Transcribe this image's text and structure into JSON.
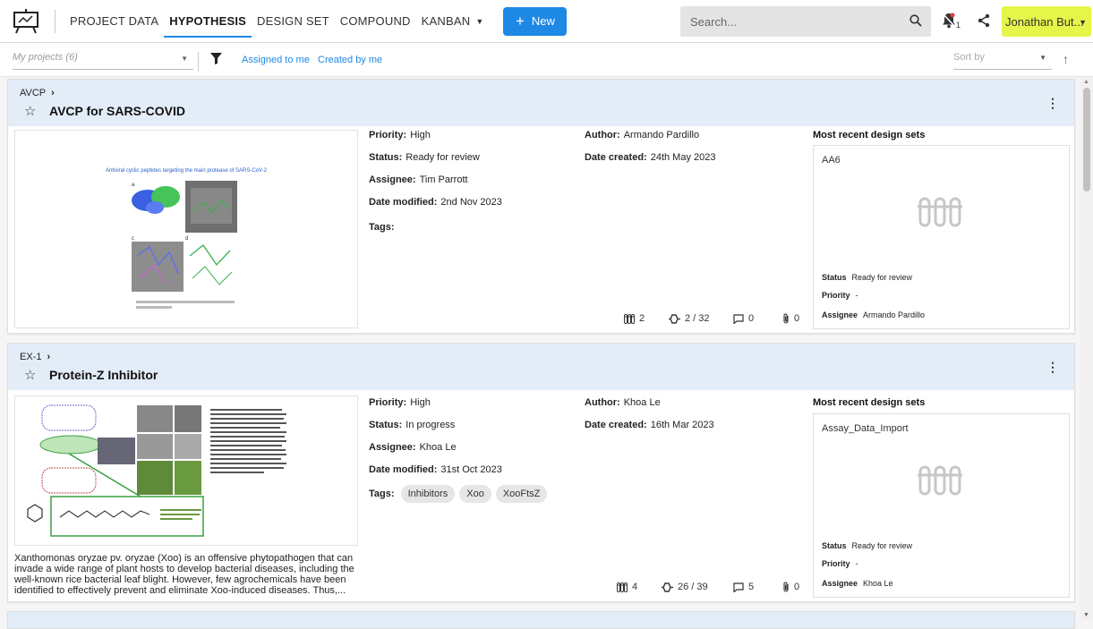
{
  "nav": {
    "items": [
      {
        "label": "PROJECT DATA",
        "active": false
      },
      {
        "label": "HYPOTHESIS",
        "active": true
      },
      {
        "label": "DESIGN SET",
        "active": false
      },
      {
        "label": "COMPOUND",
        "active": false
      },
      {
        "label": "KANBAN",
        "active": false
      }
    ],
    "new_label": "New",
    "search_placeholder": "Search...",
    "notification_count": "1",
    "user_name": "Jonathan But...",
    "accent": "#1e88e5",
    "user_color": "#e6f54a"
  },
  "filters": {
    "projects_placeholder": "My projects (6)",
    "assigned": "Assigned to me",
    "created": "Created by me",
    "sort_placeholder": "Sort by"
  },
  "cards": [
    {
      "code": "AVCP",
      "title": "AVCP for SARS-COVID",
      "priority_label": "Priority:",
      "priority": "High",
      "status_label": "Status:",
      "status": "Ready for review",
      "assignee_label": "Assignee:",
      "assignee": "Tim Parrott",
      "modified_label": "Date modified:",
      "modified": "2nd Nov 2023",
      "tags_label": "Tags:",
      "tags": [],
      "author_label": "Author:",
      "author": "Armando Pardillo",
      "created_label": "Date created:",
      "created": "24th May 2023",
      "image_caption": "Antiviral cyclic peptides targeting the main protease of SARS-CoV-2",
      "description": "",
      "stats": {
        "design_sets": "2",
        "compounds": "2 / 32",
        "comments": "0",
        "attachments": "0"
      },
      "recent_heading": "Most recent design sets",
      "recent": {
        "name": "AA6",
        "status_label": "Status",
        "status": "Ready for review",
        "priority_label": "Priority",
        "priority": "-",
        "assignee_label": "Assignee",
        "assignee": "Armando Pardillo"
      }
    },
    {
      "code": "EX-1",
      "title": "Protein-Z Inhibitor",
      "priority_label": "Priority:",
      "priority": "High",
      "status_label": "Status:",
      "status": "In progress",
      "assignee_label": "Assignee:",
      "assignee": "Khoa Le",
      "modified_label": "Date modified:",
      "modified": "31st Oct 2023",
      "tags_label": "Tags:",
      "tags": [
        "Inhibitors",
        "Xoo",
        "XooFtsZ"
      ],
      "author_label": "Author:",
      "author": "Khoa Le",
      "created_label": "Date created:",
      "created": "16th Mar 2023",
      "image_caption": "",
      "description": "Xanthomonas oryzae pv. oryzae (Xoo) is an offensive phytopathogen that can invade a wide range of plant hosts to develop bacterial diseases, including the well-known rice bacterial leaf blight. However, few agrochemicals have been identified to effectively prevent and eliminate Xoo-induced diseases. Thus,...",
      "stats": {
        "design_sets": "4",
        "compounds": "26 / 39",
        "comments": "5",
        "attachments": "0"
      },
      "recent_heading": "Most recent design sets",
      "recent": {
        "name": "Assay_Data_Import",
        "status_label": "Status",
        "status": "Ready for review",
        "priority_label": "Priority",
        "priority": "-",
        "assignee_label": "Assignee",
        "assignee": "Khoa Le"
      }
    }
  ]
}
